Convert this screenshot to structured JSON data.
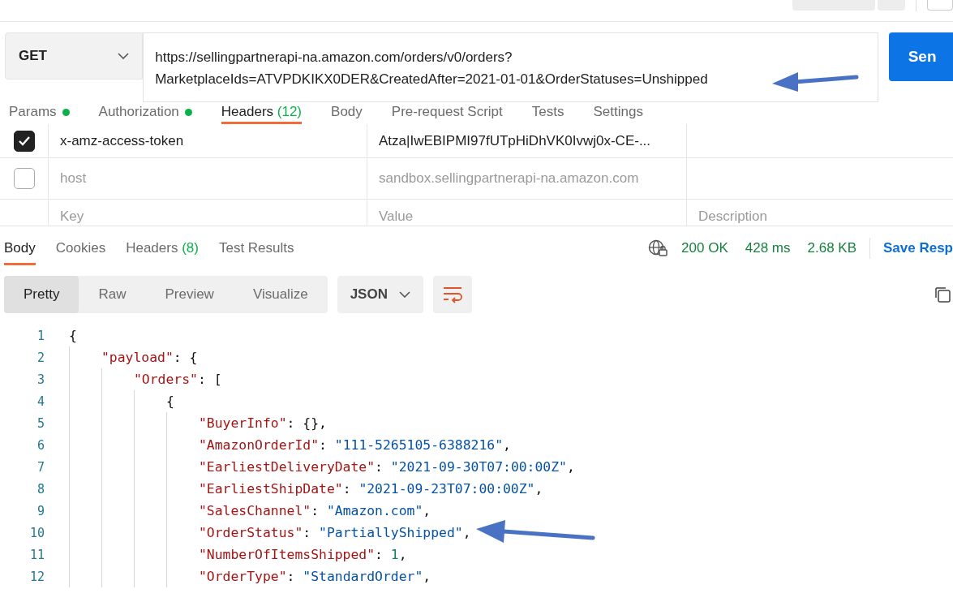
{
  "request": {
    "method": "GET",
    "url": "https://sellingpartnerapi-na.amazon.com/orders/v0/orders?MarketplaceIds=ATVPDKIKX0DER&CreatedAfter=2021-01-01&OrderStatuses=Unshipped",
    "send_label": "Sen"
  },
  "request_tabs": [
    {
      "label": "Params",
      "dot": true,
      "selected": false
    },
    {
      "label": "Authorization",
      "dot": true,
      "selected": false
    },
    {
      "label": "Headers",
      "count": "(12)",
      "dot": false,
      "selected": true
    },
    {
      "label": "Body",
      "dot": false,
      "selected": false
    },
    {
      "label": "Pre-request Script",
      "dot": false,
      "selected": false
    },
    {
      "label": "Tests",
      "dot": false,
      "selected": false
    },
    {
      "label": "Settings",
      "dot": false,
      "selected": false
    }
  ],
  "headers": [
    {
      "checked": true,
      "key": "x-amz-access-token",
      "value": "Atza|IwEBIPMI97fUTpHiDhVK0Ivwj0x-CE-..."
    },
    {
      "checked": false,
      "key": "host",
      "value": "sandbox.sellingpartnerapi-na.amazon.com"
    }
  ],
  "new_row": {
    "key": {
      "placeholder": "Key"
    },
    "value": {
      "placeholder": "Value"
    },
    "description": {
      "placeholder": "Description"
    }
  },
  "response_tabs": [
    {
      "label": "Body",
      "selected": true
    },
    {
      "label": "Cookies",
      "selected": false
    },
    {
      "label": "Headers",
      "count": "(8)",
      "selected": false
    },
    {
      "label": "Test Results",
      "selected": false
    }
  ],
  "response_meta": {
    "status": "200 OK",
    "time": "428 ms",
    "size": "2.68 KB",
    "save_label": "Save Resp"
  },
  "view_modes": [
    {
      "label": "Pretty",
      "selected": true
    },
    {
      "label": "Raw",
      "selected": false
    },
    {
      "label": "Preview",
      "selected": false
    },
    {
      "label": "Visualize",
      "selected": false
    }
  ],
  "format": "JSON",
  "code": [
    {
      "number": "1",
      "tokens": [
        {
          "kind": "punct",
          "text": "{"
        }
      ],
      "children": [
        {
          "number": "2",
          "tokens": [
            {
              "kind": "key",
              "text": "\"payload\""
            },
            {
              "kind": "punct",
              "text": ": {"
            }
          ],
          "children": [
            {
              "number": "3",
              "tokens": [
                {
                  "kind": "key",
                  "text": "\"Orders\""
                },
                {
                  "kind": "punct",
                  "text": ": ["
                }
              ],
              "children": [
                {
                  "number": "4",
                  "tokens": [
                    {
                      "kind": "punct",
                      "text": "{"
                    }
                  ],
                  "children": [
                    {
                      "number": "5",
                      "tokens": [
                        {
                          "kind": "key",
                          "text": "\"BuyerInfo\""
                        },
                        {
                          "kind": "punct",
                          "text": ": {},"
                        }
                      ]
                    },
                    {
                      "number": "6",
                      "tokens": [
                        {
                          "kind": "key",
                          "text": "\"AmazonOrderId\""
                        },
                        {
                          "kind": "punct",
                          "text": ": "
                        },
                        {
                          "kind": "string",
                          "text": "\"111-5265105-6388216\""
                        },
                        {
                          "kind": "punct",
                          "text": ","
                        }
                      ]
                    },
                    {
                      "number": "7",
                      "tokens": [
                        {
                          "kind": "key",
                          "text": "\"EarliestDeliveryDate\""
                        },
                        {
                          "kind": "punct",
                          "text": ": "
                        },
                        {
                          "kind": "string",
                          "text": "\"2021-09-30T07:00:00Z\""
                        },
                        {
                          "kind": "punct",
                          "text": ","
                        }
                      ]
                    },
                    {
                      "number": "8",
                      "tokens": [
                        {
                          "kind": "key",
                          "text": "\"EarliestShipDate\""
                        },
                        {
                          "kind": "punct",
                          "text": ": "
                        },
                        {
                          "kind": "string",
                          "text": "\"2021-09-23T07:00:00Z\""
                        },
                        {
                          "kind": "punct",
                          "text": ","
                        }
                      ]
                    },
                    {
                      "number": "9",
                      "tokens": [
                        {
                          "kind": "key",
                          "text": "\"SalesChannel\""
                        },
                        {
                          "kind": "punct",
                          "text": ": "
                        },
                        {
                          "kind": "string",
                          "text": "\"Amazon.com\""
                        },
                        {
                          "kind": "punct",
                          "text": ","
                        }
                      ]
                    },
                    {
                      "number": "10",
                      "tokens": [
                        {
                          "kind": "key",
                          "text": "\"OrderStatus\""
                        },
                        {
                          "kind": "punct",
                          "text": ": "
                        },
                        {
                          "kind": "string",
                          "text": "\"PartiallyShipped\""
                        },
                        {
                          "kind": "punct",
                          "text": ","
                        }
                      ]
                    },
                    {
                      "number": "11",
                      "tokens": [
                        {
                          "kind": "key",
                          "text": "\"NumberOfItemsShipped\""
                        },
                        {
                          "kind": "punct",
                          "text": ": "
                        },
                        {
                          "kind": "number",
                          "text": "1"
                        },
                        {
                          "kind": "punct",
                          "text": ","
                        }
                      ]
                    },
                    {
                      "number": "12",
                      "tokens": [
                        {
                          "kind": "key",
                          "text": "\"OrderType\""
                        },
                        {
                          "kind": "punct",
                          "text": ": "
                        },
                        {
                          "kind": "string",
                          "text": "\"StandardOrder\""
                        },
                        {
                          "kind": "punct",
                          "text": ","
                        }
                      ]
                    }
                  ]
                }
              ]
            }
          ]
        }
      ]
    }
  ]
}
